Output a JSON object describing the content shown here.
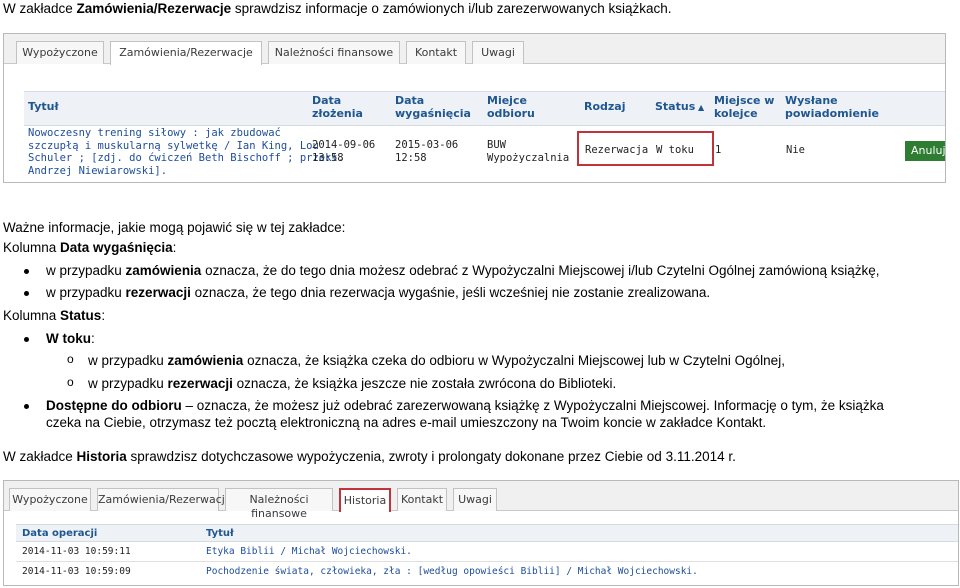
{
  "intro": {
    "pre": "W zakładce ",
    "bold": "Zamówienia/Rezerwacje",
    "post": " sprawdzisz informacje o zamówionych i/lub zarezerwowanych książkach."
  },
  "shot1": {
    "tabs": [
      "Wypożyczone",
      "Zamówienia/Rezerwacje",
      "Należności finansowe",
      "Kontakt",
      "Uwagi"
    ],
    "active_tab": 1,
    "headers": {
      "tytul": "Tytuł",
      "data_zlozenia_1": "Data",
      "data_zlozenia_2": "złożenia",
      "data_wygasniecia_1": "Data",
      "data_wygasniecia_2": "wygaśnięcia",
      "miejsce_odbioru_1": "Miejce",
      "miejsce_odbioru_2": "odbioru",
      "rodzaj": "Rodzaj",
      "status": "Status",
      "miejsce_w_kolejce_1": "Miejsce w",
      "miejsce_w_kolejce_2": "kolejce",
      "wyslane_powiadomienie_1": "Wysłane",
      "wyslane_powiadomienie_2": "powiadomienie"
    },
    "row": {
      "title_lines": [
        "Nowoczesny trening siłowy : jak zbudować",
        "szczupłą i muskularną sylwetkę / Ian King, Lou",
        "Schuler ; [zdj. do ćwiczeń Beth Bischoff ; przekł.",
        "Andrzej Niewiarowski]."
      ],
      "data_zlozenia_date": "2014-09-06",
      "data_zlozenia_time": "13:58",
      "data_wygasniecia_date": "2015-03-06",
      "data_wygasniecia_time": "12:58",
      "miejsce_1": "BUW",
      "miejsce_2": "Wypożyczalnia",
      "rodzaj": "Rezerwacja",
      "status": "W toku",
      "kolejka": "1",
      "powiadomienie": "Nie",
      "action": "Anuluj"
    }
  },
  "wazne": "Ważne informacje, jakie mogą pojawić się w tej zakładce:",
  "kolumna_data": {
    "pre": "Kolumna ",
    "bold": "Data wygaśnięcia",
    "post": ":"
  },
  "bullets_data": [
    {
      "pre": "w przypadku ",
      "bold": "zamówienia",
      "post": " oznacza, że do tego dnia możesz odebrać z Wypożyczalni Miejscowej i/lub Czytelni Ogólnej zamówioną książkę,"
    },
    {
      "pre": "w przypadku ",
      "bold": "rezerwacji",
      "post": " oznacza, że tego dnia rezerwacja wygaśnie, jeśli wcześniej nie zostanie zrealizowana."
    }
  ],
  "kolumna_status": {
    "pre": "Kolumna ",
    "bold": "Status",
    "post": ":"
  },
  "w_toku": {
    "bold": "W toku",
    "post": ":"
  },
  "sub_bullet_marker": "o",
  "sub_bullets": [
    {
      "pre": "w przypadku ",
      "bold": "zamówienia",
      "post": " oznacza, że książka czeka do odbioru w Wypożyczalni Miejscowej lub w Czytelni Ogólnej,"
    },
    {
      "pre": "w przypadku ",
      "bold": "rezerwacji",
      "post": " oznacza, że książka jeszcze nie została zwrócona do Biblioteki."
    }
  ],
  "dostepne": {
    "bold": "Dostępne do odbioru",
    "post_line1": " – oznacza, że możesz już odebrać zarezerwowaną książkę z Wypożyczalni Miejscowej. Informację o tym, że książka",
    "line2": "czeka na Ciebie, otrzymasz też pocztą elektroniczną na adres e-mail umieszczony na Twoim koncie w zakładce Kontakt."
  },
  "historia": {
    "pre": "W zakładce ",
    "bold": "Historia",
    "post": " sprawdzisz dotychczasowe wypożyczenia, zwroty i prolongaty dokonane przez Ciebie od 3.11.2014 r."
  },
  "shot2": {
    "tabs": [
      "Wypożyczone",
      "Zamówienia/Rezerwacje",
      "Należności finansowe",
      "Historia",
      "Kontakt",
      "Uwagi"
    ],
    "active_tab": 3,
    "headers": {
      "data_operacji": "Data operacji",
      "tytul": "Tytuł"
    },
    "rows": [
      {
        "date": "2014-11-03 10:59:11",
        "title": "Etyka Biblii / Michał Wojciechowski."
      },
      {
        "date": "2014-11-03 10:59:09",
        "title": "Pochodzenie świata, człowieka, zła : [według opowieści Biblii] / Michał Wojciechowski."
      }
    ]
  }
}
